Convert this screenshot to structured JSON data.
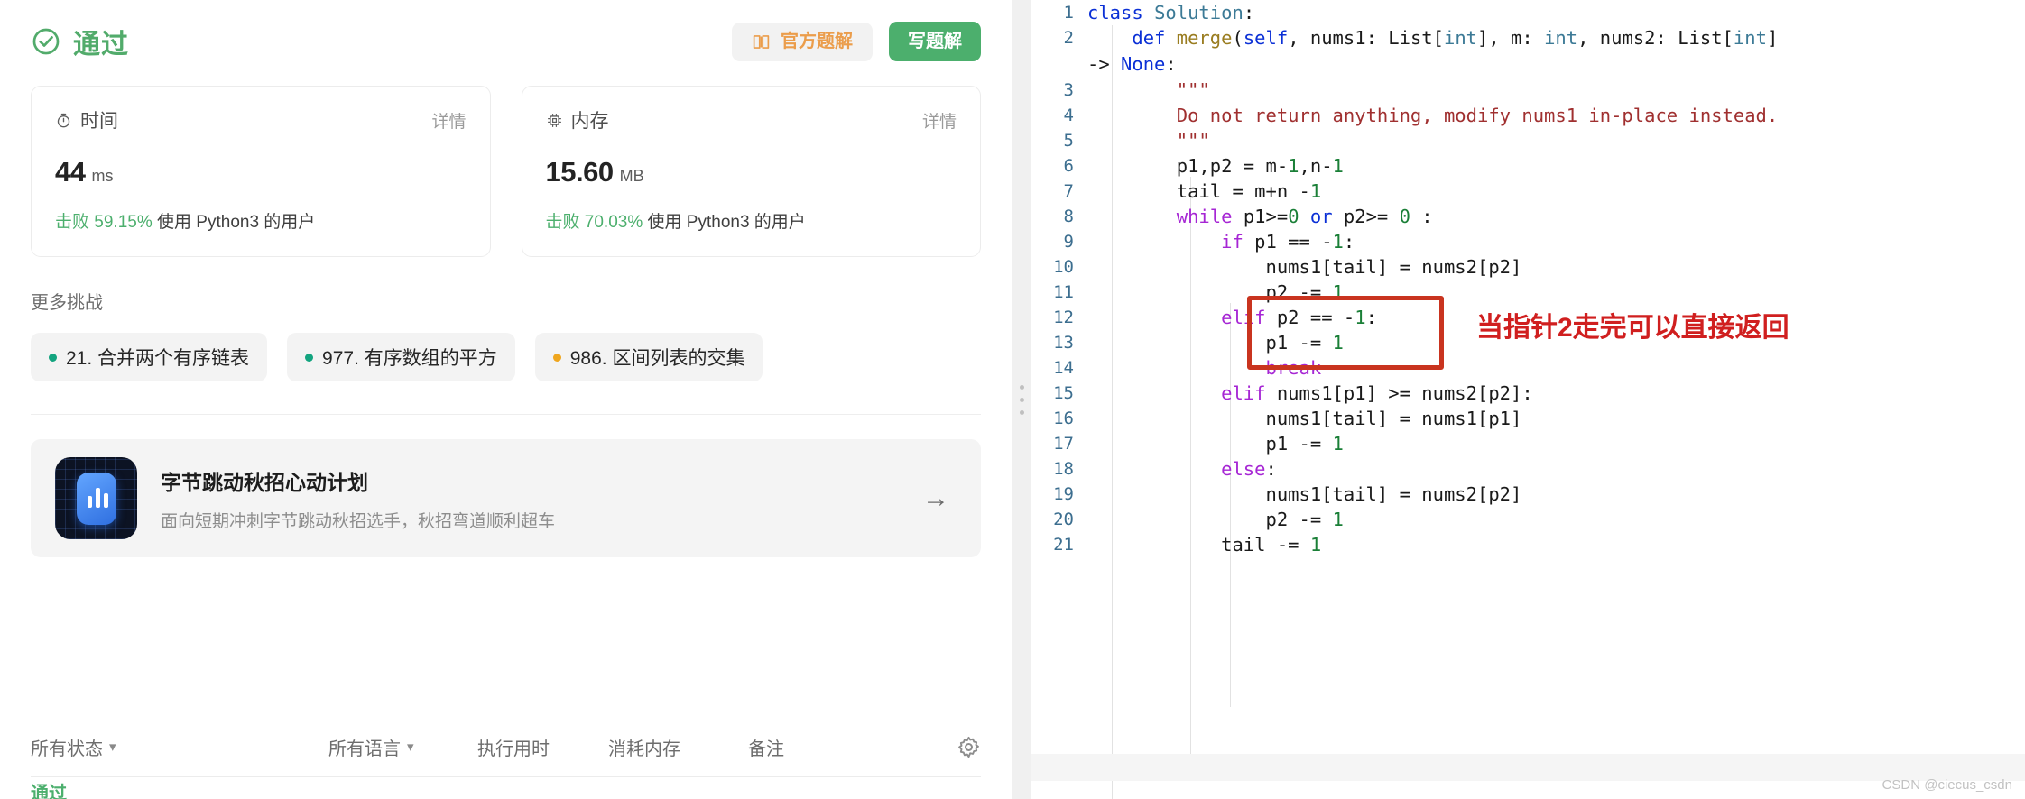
{
  "submission": {
    "status_label": "通过",
    "status_color": "#52ab6b",
    "official_solution_label": "官方题解",
    "write_solution_label": "写题解",
    "stats": [
      {
        "icon": "stopwatch-icon",
        "title": "时间",
        "detail_label": "详情",
        "value": "44",
        "unit": "ms",
        "beat_prefix": "击败",
        "beat_percent": "59.15%",
        "beat_suffix": "使用 Python3 的用户"
      },
      {
        "icon": "memory-chip-icon",
        "title": "内存",
        "detail_label": "详情",
        "value": "15.60",
        "unit": "MB",
        "beat_prefix": "击败",
        "beat_percent": "70.03%",
        "beat_suffix": "使用 Python3 的用户"
      }
    ]
  },
  "more_challenges": {
    "title": "更多挑战",
    "items": [
      {
        "label": "21. 合并两个有序链表",
        "difficulty_color": "#13a47f"
      },
      {
        "label": "977. 有序数组的平方",
        "difficulty_color": "#13a47f"
      },
      {
        "label": "986. 区间列表的交集",
        "difficulty_color": "#efa61e"
      }
    ]
  },
  "ad": {
    "title": "字节跳动秋招心动计划",
    "subtitle": "面向短期冲刺字节跳动秋招选手，秋招弯道顺利超车",
    "arrow_icon": "arrow-right-icon"
  },
  "filters": {
    "status": "所有状态",
    "language": "所有语言",
    "runtime": "执行用时",
    "memory": "消耗内存",
    "note": "备注",
    "caret_icon": "chevron-down-icon",
    "settings_icon": "gear-icon",
    "first_row_status": "通过"
  },
  "splitter": {
    "handle_icon": "drag-dots-icon"
  },
  "editor": {
    "watermark": "CSDN @ciecus_csdn",
    "annotation": {
      "text": "当指针2走完可以直接返回",
      "color": "#d01f1f"
    },
    "lines": [
      {
        "no": "1",
        "tokens": [
          {
            "t": "class ",
            "c": "kb"
          },
          {
            "t": "Solution",
            "c": "ty"
          },
          {
            "t": ":",
            "c": "pl"
          }
        ]
      },
      {
        "no": "2",
        "tokens": [
          {
            "t": "    ",
            "c": "pl"
          },
          {
            "t": "def ",
            "c": "kb"
          },
          {
            "t": "merge",
            "c": "fn"
          },
          {
            "t": "(",
            "c": "pl"
          },
          {
            "t": "self",
            "c": "kb"
          },
          {
            "t": ", nums1: List[",
            "c": "pl"
          },
          {
            "t": "int",
            "c": "ty"
          },
          {
            "t": "], ",
            "c": "pl"
          },
          {
            "t": "m",
            "c": "pl"
          },
          {
            "t": ": ",
            "c": "pl"
          },
          {
            "t": "int",
            "c": "ty"
          },
          {
            "t": ", nums2: List[",
            "c": "pl"
          },
          {
            "t": "int",
            "c": "ty"
          },
          {
            "t": "]",
            "c": "pl"
          }
        ]
      },
      {
        "no": "",
        "wrap": true,
        "tokens": [
          {
            "t": "-> ",
            "c": "pl"
          },
          {
            "t": "None",
            "c": "kb"
          },
          {
            "t": ":",
            "c": "pl"
          }
        ]
      },
      {
        "no": "3",
        "tokens": [
          {
            "t": "        ",
            "c": "pl"
          },
          {
            "t": "\"\"\"",
            "c": "st"
          }
        ]
      },
      {
        "no": "4",
        "tokens": [
          {
            "t": "        ",
            "c": "pl"
          },
          {
            "t": "Do not return anything, modify nums1 in-place instead.",
            "c": "st"
          }
        ]
      },
      {
        "no": "5",
        "tokens": [
          {
            "t": "        ",
            "c": "pl"
          },
          {
            "t": "\"\"\"",
            "c": "st"
          }
        ]
      },
      {
        "no": "6",
        "tokens": [
          {
            "t": "        p1,p2 = m-",
            "c": "pl"
          },
          {
            "t": "1",
            "c": "nm"
          },
          {
            "t": ",n-",
            "c": "pl"
          },
          {
            "t": "1",
            "c": "nm"
          }
        ]
      },
      {
        "no": "7",
        "tokens": [
          {
            "t": "        tail = m+n -",
            "c": "pl"
          },
          {
            "t": "1",
            "c": "nm"
          }
        ]
      },
      {
        "no": "8",
        "tokens": [
          {
            "t": "        ",
            "c": "pl"
          },
          {
            "t": "while ",
            "c": "k"
          },
          {
            "t": "p1>=",
            "c": "pl"
          },
          {
            "t": "0",
            "c": "nm"
          },
          {
            "t": " ",
            "c": "pl"
          },
          {
            "t": "or",
            "c": "kb"
          },
          {
            "t": " p2>= ",
            "c": "pl"
          },
          {
            "t": "0",
            "c": "nm"
          },
          {
            "t": " :",
            "c": "pl"
          }
        ]
      },
      {
        "no": "9",
        "tokens": [
          {
            "t": "            ",
            "c": "pl"
          },
          {
            "t": "if ",
            "c": "k"
          },
          {
            "t": "p1 == -",
            "c": "pl"
          },
          {
            "t": "1",
            "c": "nm"
          },
          {
            "t": ":",
            "c": "pl"
          }
        ]
      },
      {
        "no": "10",
        "tokens": [
          {
            "t": "                nums1[tail] = nums2[p2]",
            "c": "pl"
          }
        ]
      },
      {
        "no": "11",
        "tokens": [
          {
            "t": "                p2 -= ",
            "c": "pl"
          },
          {
            "t": "1",
            "c": "nm"
          }
        ]
      },
      {
        "no": "12",
        "tokens": [
          {
            "t": "            ",
            "c": "pl"
          },
          {
            "t": "elif ",
            "c": "k"
          },
          {
            "t": "p2 == -",
            "c": "pl"
          },
          {
            "t": "1",
            "c": "nm"
          },
          {
            "t": ":",
            "c": "pl"
          }
        ]
      },
      {
        "no": "13",
        "tokens": [
          {
            "t": "                p1 -= ",
            "c": "pl"
          },
          {
            "t": "1",
            "c": "nm"
          }
        ]
      },
      {
        "no": "14",
        "tokens": [
          {
            "t": "                ",
            "c": "pl"
          },
          {
            "t": "break",
            "c": "k"
          }
        ]
      },
      {
        "no": "15",
        "tokens": [
          {
            "t": "            ",
            "c": "pl"
          },
          {
            "t": "elif ",
            "c": "k"
          },
          {
            "t": "nums1[p1] >= nums2[p2]:",
            "c": "pl"
          }
        ]
      },
      {
        "no": "16",
        "tokens": [
          {
            "t": "                nums1[tail] = nums1[p1]",
            "c": "pl"
          }
        ]
      },
      {
        "no": "17",
        "tokens": [
          {
            "t": "                p1 -= ",
            "c": "pl"
          },
          {
            "t": "1",
            "c": "nm"
          }
        ]
      },
      {
        "no": "18",
        "tokens": [
          {
            "t": "            ",
            "c": "pl"
          },
          {
            "t": "else",
            "c": "k"
          },
          {
            "t": ":",
            "c": "pl"
          }
        ]
      },
      {
        "no": "19",
        "tokens": [
          {
            "t": "                nums1[tail] = nums2[p2]",
            "c": "pl"
          }
        ]
      },
      {
        "no": "20",
        "tokens": [
          {
            "t": "                p2 -= ",
            "c": "pl"
          },
          {
            "t": "1",
            "c": "nm"
          }
        ]
      },
      {
        "no": "21",
        "tokens": [
          {
            "t": "            tail -= ",
            "c": "pl"
          },
          {
            "t": "1",
            "c": "nm"
          }
        ]
      }
    ]
  }
}
